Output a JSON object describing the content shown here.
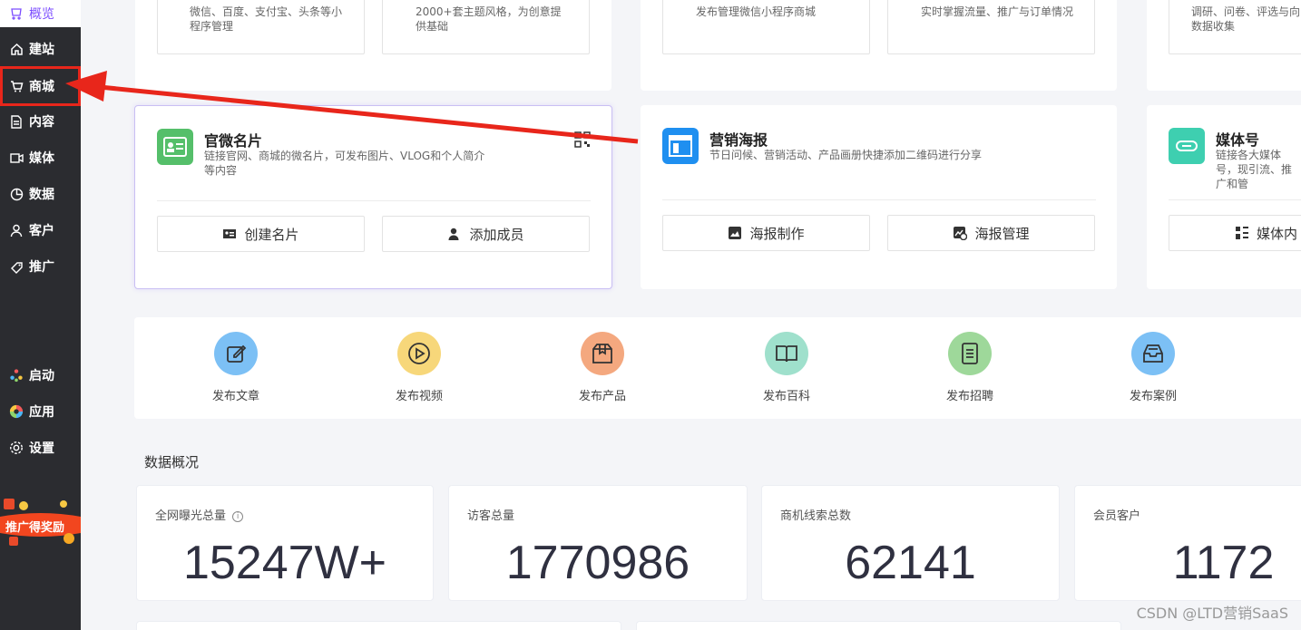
{
  "sidebar": {
    "overview": "概览",
    "items": [
      {
        "label": "建站",
        "icon": "home-icon"
      },
      {
        "label": "商城",
        "icon": "cart-icon"
      },
      {
        "label": "内容",
        "icon": "document-icon"
      },
      {
        "label": "媒体",
        "icon": "video-icon"
      },
      {
        "label": "数据",
        "icon": "pie-icon"
      },
      {
        "label": "客户",
        "icon": "user-icon"
      },
      {
        "label": "推广",
        "icon": "tag-icon"
      }
    ],
    "bottom": [
      {
        "label": "启动",
        "icon": "launch-icon"
      },
      {
        "label": "应用",
        "icon": "apps-icon"
      },
      {
        "label": "设置",
        "icon": "gear-icon"
      }
    ],
    "promo": "推广得奖励"
  },
  "top_row": {
    "a1_desc": "微信、百度、支付宝、头条等小程序管理",
    "a2_desc": "2000+套主题风格，为创意提供基础",
    "b1_desc": "发布管理微信小程序商城",
    "b2_desc": "实时掌握流量、推广与订单情况",
    "c1_desc": "调研、问卷、评选与向数据收集"
  },
  "cards": {
    "weicard": {
      "title": "官微名片",
      "desc": "链接官网、商城的微名片，可发布图片、VLOG和个人简介等内容",
      "btn1": "创建名片",
      "btn2": "添加成员"
    },
    "poster": {
      "title": "营销海报",
      "desc": "节日问候、营销活动、产品画册快捷添加二维码进行分享",
      "btn1": "海报制作",
      "btn2": "海报管理"
    },
    "media": {
      "title": "媒体号",
      "desc": "链接各大媒体号，现引流、推广和管",
      "btn1": "媒体内"
    }
  },
  "quick_actions": [
    {
      "label": "发布文章",
      "color": "#7cc0f5",
      "icon": "edit-icon"
    },
    {
      "label": "发布视频",
      "color": "#f7d77a",
      "icon": "play-icon"
    },
    {
      "label": "发布产品",
      "color": "#f4a87f",
      "icon": "box-icon"
    },
    {
      "label": "发布百科",
      "color": "#9fe0cc",
      "icon": "book-icon"
    },
    {
      "label": "发布招聘",
      "color": "#9ed89a",
      "icon": "list-icon"
    },
    {
      "label": "发布案例",
      "color": "#7cc0f5",
      "icon": "inbox-icon"
    }
  ],
  "data_overview": {
    "title": "数据概况",
    "stats": [
      {
        "label": "全网曝光总量",
        "value": "15247W+"
      },
      {
        "label": "访客总量",
        "value": "1770986"
      },
      {
        "label": "商机线索总数",
        "value": "62141"
      },
      {
        "label": "会员客户",
        "value": "1172"
      }
    ]
  },
  "watermark": "CSDN @LTD营销SaaS",
  "colors": {
    "accent": "#7c4dff",
    "highlight_red": "#e8261b",
    "sidebar_bg": "#2b2c30"
  }
}
